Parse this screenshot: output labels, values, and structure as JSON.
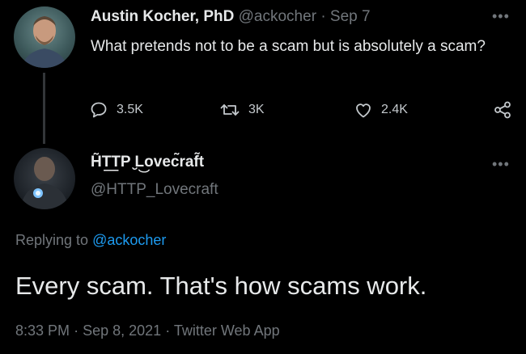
{
  "parent_tweet": {
    "author_name": "Austin Kocher, PhD",
    "author_handle": "@ackocher",
    "separator": "·",
    "date": "Sep 7",
    "text": "What pretends not to be a scam but is absolutely a scam?",
    "more_icon": "ellipsis-icon",
    "stats": {
      "replies": "3.5K",
      "retweets": "3K",
      "likes": "2.4K"
    },
    "icons": {
      "reply": "speech-bubble-icon",
      "retweet": "retweet-arrows-icon",
      "like": "heart-icon",
      "share": "share-icon"
    }
  },
  "reply_tweet": {
    "author_name": "H͂T͟TP ̮L͜ovec͂raf͂t",
    "author_handle": "@HTTP_Lovecraft",
    "more_icon": "ellipsis-icon",
    "replying_to_label": "Replying to",
    "replying_to_handle": "@ackocher",
    "text": "Every scam. That's how scams work.",
    "time": "8:33 PM",
    "separator": "·",
    "date": "Sep 8, 2021",
    "client": "Twitter Web App"
  },
  "colors": {
    "background": "#000000",
    "text_primary": "#e7e9ea",
    "text_muted": "#71767b",
    "link": "#1d9bf0",
    "thread_line": "#333639"
  }
}
